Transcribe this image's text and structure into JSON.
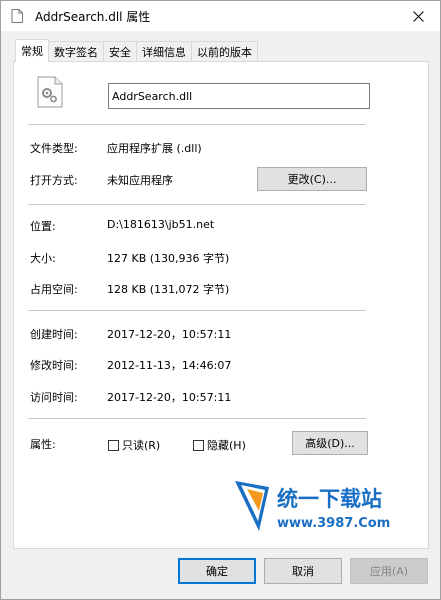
{
  "window": {
    "title": "AddrSearch.dll 属性"
  },
  "tabs": [
    {
      "label": "常规"
    },
    {
      "label": "数字签名"
    },
    {
      "label": "安全"
    },
    {
      "label": "详细信息"
    },
    {
      "label": "以前的版本"
    }
  ],
  "general": {
    "filename": "AddrSearch.dll",
    "file_type_label": "文件类型:",
    "file_type_value": "应用程序扩展 (.dll)",
    "open_with_label": "打开方式:",
    "open_with_value": "未知应用程序",
    "change_button": "更改(C)...",
    "location_label": "位置:",
    "location_value": "D:\\181613\\jb51.net",
    "size_label": "大小:",
    "size_value": "127 KB (130,936 字节)",
    "size_on_disk_label": "占用空间:",
    "size_on_disk_value": "128 KB (131,072 字节)",
    "created_label": "创建时间:",
    "created_value": "2017-12-20，10:57:11",
    "modified_label": "修改时间:",
    "modified_value": "2012-11-13，14:46:07",
    "accessed_label": "访问时间:",
    "accessed_value": "2017-12-20，10:57:11",
    "attributes_label": "属性:",
    "readonly_label": "只读(R)",
    "hidden_label": "隐藏(H)",
    "advanced_button": "高级(D)..."
  },
  "watermark": {
    "name": "统一下载站",
    "url": "www.3987.Com"
  },
  "footer": {
    "ok": "确定",
    "cancel": "取消",
    "apply": "应用(A)"
  },
  "colors": {
    "primary_border": "#0078d7",
    "watermark_blue": "#1a6fc4",
    "watermark_orange": "#f39a1e"
  }
}
